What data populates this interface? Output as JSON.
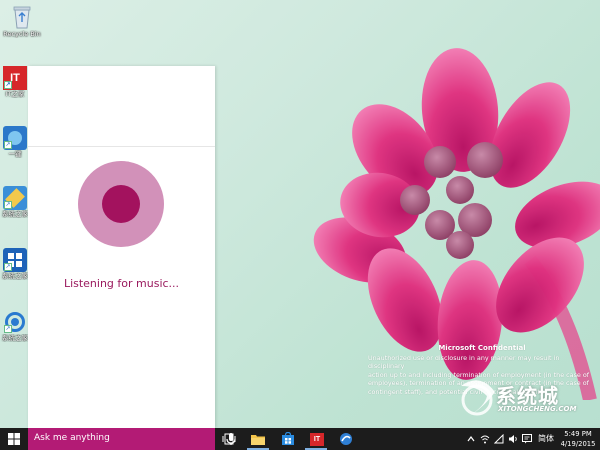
{
  "desktop": {
    "icons": [
      {
        "label": "Recycle Bin",
        "icon": "recycle-bin-icon"
      },
      {
        "label": "IT之家",
        "icon": "it-home-icon"
      },
      {
        "label": "一键",
        "icon": "app-icon"
      },
      {
        "label": "系统之家",
        "icon": "app-icon"
      },
      {
        "label": "系统之家",
        "icon": "app-icon"
      },
      {
        "label": "系统之家",
        "icon": "app-icon"
      }
    ],
    "watermark": {
      "title": "Microsoft Confidential",
      "lines": [
        "Unauthorized use or disclosure in any manner may result in disciplinary",
        "action up to and including termination of employment (in the case of",
        "employees), termination of an assignment or contract (in the case of",
        "contingent staff), and potential civil or criminal liability."
      ]
    },
    "brand": {
      "text": "系统城",
      "sub": "XITONGCHENG.COM"
    }
  },
  "cortana": {
    "status": "Listening for music...",
    "colors": {
      "outer": "#d291b9",
      "inner": "#a3125e",
      "text": "#9a1a5e"
    }
  },
  "taskbar": {
    "search_placeholder": "Ask me anything",
    "accent": "#b31b75",
    "apps": [
      "task-view-icon",
      "file-explorer-icon",
      "store-icon",
      "it-home-icon",
      "browser-icon"
    ],
    "tray": {
      "language": "简体",
      "time": "5:49 PM",
      "date": "4/19/2015"
    }
  }
}
